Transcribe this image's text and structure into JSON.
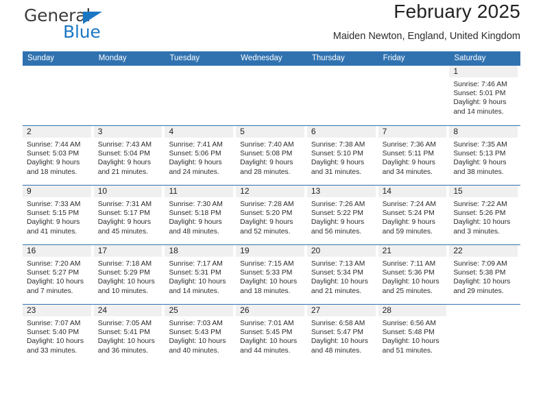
{
  "brand": {
    "name_part1": "General",
    "name_part2": "Blue",
    "accent_color": "#1b77c4"
  },
  "header": {
    "title": "February 2025",
    "subtitle": "Maiden Newton, England, United Kingdom"
  },
  "theme": {
    "header_blue": "#3072b0",
    "day_band_gray": "#f0f0f0",
    "text": "#222222"
  },
  "weekdays": [
    "Sunday",
    "Monday",
    "Tuesday",
    "Wednesday",
    "Thursday",
    "Friday",
    "Saturday"
  ],
  "labels": {
    "sunrise": "Sunrise:",
    "sunset": "Sunset:",
    "daylight": "Daylight:"
  },
  "weeks": [
    [
      {
        "date": "",
        "blank": true
      },
      {
        "date": "",
        "blank": true
      },
      {
        "date": "",
        "blank": true
      },
      {
        "date": "",
        "blank": true
      },
      {
        "date": "",
        "blank": true
      },
      {
        "date": "",
        "blank": true
      },
      {
        "date": "1",
        "sunrise": "Sunrise: 7:46 AM",
        "sunset": "Sunset: 5:01 PM",
        "daylight": "Daylight: 9 hours and 14 minutes."
      }
    ],
    [
      {
        "date": "2",
        "sunrise": "Sunrise: 7:44 AM",
        "sunset": "Sunset: 5:03 PM",
        "daylight": "Daylight: 9 hours and 18 minutes."
      },
      {
        "date": "3",
        "sunrise": "Sunrise: 7:43 AM",
        "sunset": "Sunset: 5:04 PM",
        "daylight": "Daylight: 9 hours and 21 minutes."
      },
      {
        "date": "4",
        "sunrise": "Sunrise: 7:41 AM",
        "sunset": "Sunset: 5:06 PM",
        "daylight": "Daylight: 9 hours and 24 minutes."
      },
      {
        "date": "5",
        "sunrise": "Sunrise: 7:40 AM",
        "sunset": "Sunset: 5:08 PM",
        "daylight": "Daylight: 9 hours and 28 minutes."
      },
      {
        "date": "6",
        "sunrise": "Sunrise: 7:38 AM",
        "sunset": "Sunset: 5:10 PM",
        "daylight": "Daylight: 9 hours and 31 minutes."
      },
      {
        "date": "7",
        "sunrise": "Sunrise: 7:36 AM",
        "sunset": "Sunset: 5:11 PM",
        "daylight": "Daylight: 9 hours and 34 minutes."
      },
      {
        "date": "8",
        "sunrise": "Sunrise: 7:35 AM",
        "sunset": "Sunset: 5:13 PM",
        "daylight": "Daylight: 9 hours and 38 minutes."
      }
    ],
    [
      {
        "date": "9",
        "sunrise": "Sunrise: 7:33 AM",
        "sunset": "Sunset: 5:15 PM",
        "daylight": "Daylight: 9 hours and 41 minutes."
      },
      {
        "date": "10",
        "sunrise": "Sunrise: 7:31 AM",
        "sunset": "Sunset: 5:17 PM",
        "daylight": "Daylight: 9 hours and 45 minutes."
      },
      {
        "date": "11",
        "sunrise": "Sunrise: 7:30 AM",
        "sunset": "Sunset: 5:18 PM",
        "daylight": "Daylight: 9 hours and 48 minutes."
      },
      {
        "date": "12",
        "sunrise": "Sunrise: 7:28 AM",
        "sunset": "Sunset: 5:20 PM",
        "daylight": "Daylight: 9 hours and 52 minutes."
      },
      {
        "date": "13",
        "sunrise": "Sunrise: 7:26 AM",
        "sunset": "Sunset: 5:22 PM",
        "daylight": "Daylight: 9 hours and 56 minutes."
      },
      {
        "date": "14",
        "sunrise": "Sunrise: 7:24 AM",
        "sunset": "Sunset: 5:24 PM",
        "daylight": "Daylight: 9 hours and 59 minutes."
      },
      {
        "date": "15",
        "sunrise": "Sunrise: 7:22 AM",
        "sunset": "Sunset: 5:26 PM",
        "daylight": "Daylight: 10 hours and 3 minutes."
      }
    ],
    [
      {
        "date": "16",
        "sunrise": "Sunrise: 7:20 AM",
        "sunset": "Sunset: 5:27 PM",
        "daylight": "Daylight: 10 hours and 7 minutes."
      },
      {
        "date": "17",
        "sunrise": "Sunrise: 7:18 AM",
        "sunset": "Sunset: 5:29 PM",
        "daylight": "Daylight: 10 hours and 10 minutes."
      },
      {
        "date": "18",
        "sunrise": "Sunrise: 7:17 AM",
        "sunset": "Sunset: 5:31 PM",
        "daylight": "Daylight: 10 hours and 14 minutes."
      },
      {
        "date": "19",
        "sunrise": "Sunrise: 7:15 AM",
        "sunset": "Sunset: 5:33 PM",
        "daylight": "Daylight: 10 hours and 18 minutes."
      },
      {
        "date": "20",
        "sunrise": "Sunrise: 7:13 AM",
        "sunset": "Sunset: 5:34 PM",
        "daylight": "Daylight: 10 hours and 21 minutes."
      },
      {
        "date": "21",
        "sunrise": "Sunrise: 7:11 AM",
        "sunset": "Sunset: 5:36 PM",
        "daylight": "Daylight: 10 hours and 25 minutes."
      },
      {
        "date": "22",
        "sunrise": "Sunrise: 7:09 AM",
        "sunset": "Sunset: 5:38 PM",
        "daylight": "Daylight: 10 hours and 29 minutes."
      }
    ],
    [
      {
        "date": "23",
        "sunrise": "Sunrise: 7:07 AM",
        "sunset": "Sunset: 5:40 PM",
        "daylight": "Daylight: 10 hours and 33 minutes."
      },
      {
        "date": "24",
        "sunrise": "Sunrise: 7:05 AM",
        "sunset": "Sunset: 5:41 PM",
        "daylight": "Daylight: 10 hours and 36 minutes."
      },
      {
        "date": "25",
        "sunrise": "Sunrise: 7:03 AM",
        "sunset": "Sunset: 5:43 PM",
        "daylight": "Daylight: 10 hours and 40 minutes."
      },
      {
        "date": "26",
        "sunrise": "Sunrise: 7:01 AM",
        "sunset": "Sunset: 5:45 PM",
        "daylight": "Daylight: 10 hours and 44 minutes."
      },
      {
        "date": "27",
        "sunrise": "Sunrise: 6:58 AM",
        "sunset": "Sunset: 5:47 PM",
        "daylight": "Daylight: 10 hours and 48 minutes."
      },
      {
        "date": "28",
        "sunrise": "Sunrise: 6:56 AM",
        "sunset": "Sunset: 5:48 PM",
        "daylight": "Daylight: 10 hours and 51 minutes."
      },
      {
        "date": "",
        "blank": true
      }
    ]
  ]
}
